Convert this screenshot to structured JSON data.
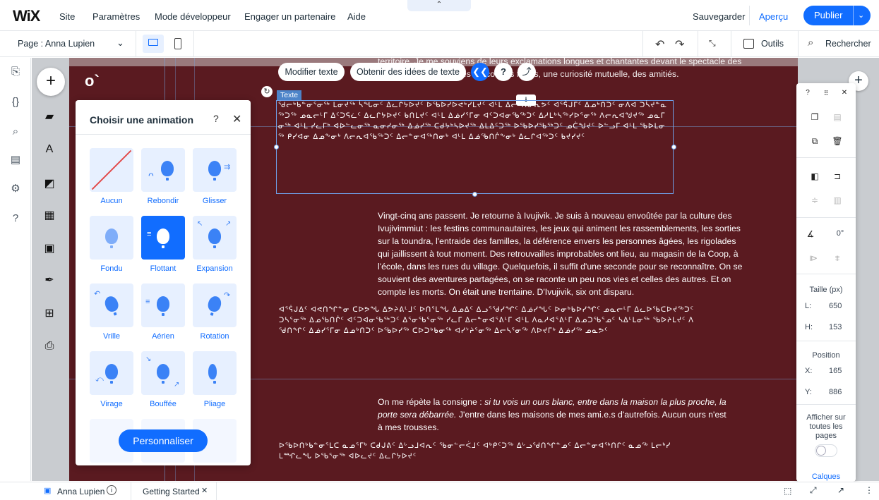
{
  "topbar": {
    "logo": "WiX",
    "menu": [
      "Site",
      "Paramètres",
      "Mode développeur",
      "Engager un partenaire",
      "Aide"
    ],
    "save": "Sauvegarder",
    "preview": "Aperçu",
    "publish": "Publier"
  },
  "secbar": {
    "page_label": "Page : Anna Lupien",
    "tools": "Outils",
    "search": "Rechercher"
  },
  "canvas": {
    "selection_tag": "Texte",
    "floating_toolbar": {
      "edit_text": "Modifier texte",
      "text_ideas": "Obtenir des idées de texte"
    },
    "top_text": "territoire. Je me souviens de leurs exclamations longues et chantantes devant le spectacle des mondes, mais aussi des rencontres fortes, une curiosité mutuelle, des amitiés.",
    "selected_syllabics": "ᖁᓕᒃᑲᓐᓂᕐᓂᖅ ᒪᓂᔪᖅ ᓵᖓᓂᑦ ᐃᓚᒋᔭᐅᔪᑦ ᐅᖃᐅᓯᐅᕙᒃᓯᒪᔪᑦ ᐊᒻᒪ ᐃᓕᑦᑎᓂᕆᕗᑦ ᐊᕐᕌᒍᒥᑦ ᐃᓄᒃᑎᑐᑦ ᓂᐱᐊ ᑐᓵᔪᓐᓇᖅᑐᖅ ᓄᓇᓕᒻᒥ ᐃᑦᑐᕋᓛᑦ ᐃᓚᒋᔭᐅᔪᑦ ᑲᑎᒪᔪᑦ ᐊᒻᒪ ᐃᓅᓯᕐᒥᓂ ᐊᑦᑐᐊᓂᖃᖅᑐᑦ ᐃᓱᒪᒃᓴᖅᓯᐅᕐᓂᖅ ᐱᓕᕆᐊᖑᔪᖅ ᓄᓇᒥᓂᖅ ᐊᒻᒪ ᓯᓚᒥᒃ ᐊᐅᓪᓚᓂᖅ ᓇᓂᓯᓂᖅ ᐃᓅᓯᖅ ᑕᑯᔭᒃᓴᐅᔪᖅ ᐃᒪᐃᑦᑐᖅ ᐅᖃᐅᓯᖃᖅᑐᑦ ᓄᑖᖑᔪᑦ ᐅᓪᓗᒥ ᐊᒻᒪ ᖃᐅᒪᓂᖅ ᑭᓯᐊᓂ ᐃᓄᖕᓂᒃ ᐱᓕᕆᐊᖃᖅᑐᑦ ᐃᓕᓐᓂᐊᖅᑎᓂᒃ ᐊᒻᒪ ᐃᓅᖃᑎᒌᖕᓂᒃ ᐃᓚᒋᐊᖅᑐᑦ ᑲᔪᓯᔪᑦ",
    "paragraph2": "Vingt-cinq ans passent. Je retourne à Ivujivik. Je suis à nouveau envoûtée par la culture des Ivujivimmiut : les festins communautaires, les jeux qui animent les rassemblements, les sorties sur la toundra, l'entraide des familles, la déférence envers les personnes âgées, les rigolades qui jaillissent à tout moment. Des retrouvailles improbables ont lieu, au magasin de la Coop, à l'école, dans les rues du village. Quelquefois, il suffit d'une seconde pour se reconnaître. On se souvient des aventures partagées, on se raconte un peu nos vies et celles des autres. Et on compte les morts. On était une trentaine. D'Ivujivik, six ont disparu.",
    "syllabics2": "ᐊᕐᕌᒍᐃᑦ ᐊᕙᑎᖏᓐᓂ ᑕᐅᕗᖓ ᐃᕗᔨᕕᒻᒧᑦ ᐅᑎᕐᒪᖓ ᐃᓄᐃᑦ ᐃᓗᕐᖁᓯᖏᑦ ᐃᓅᓯᖓᑦ ᐅᓂᒃᑲᐅᓯᖏᑦ ᓄᓇᓕᒻᒥ ᐃᓚᐅᖃᑕᐅᔪᖅᑐᑦ ᑐᓴᕐᓂᖅ ᐃᓄᖃᑎᒌᑦ ᐊᑦᑐᐊᓂᖃᖅᑐᑦ ᐃᕐᓂᖃᕐᓂᖅ ᓯᓚᒥ ᐃᓕᓐᓂᐊᕐᕕᒻᒥ ᐊᒻᒪ ᐱᓇᓱᐊᕐᕕᒻᒥ ᐃᓄᑐᖃᕐᓄᑦ ᓴᐃᒻᒪᓂᖅ ᖃᐅᔨᒪᔪᑦ ᐱᖁᑎᖏᑦ ᐃᓅᓯᕐᒥᓂ ᐃᓄᒃᑎᑐᑦ ᐅᖃᐅᓯᖅ ᑕᐅᑐᒃᑲᓂᖅ ᐊᓯᔾᔨᕐᓂᖅ ᐃᓕᓴᕐᓂᖅ ᐱᐅᔪᒥᒃ ᐃᓅᓯᖅ ᓄᓇᕗᑦ",
    "paragraph3_prefix": "On me répète la consigne : ",
    "paragraph3_italic": "si tu vois un ours blanc, entre dans la maison la plus proche, la porte sera débarrée.",
    "paragraph3_suffix": " J'entre dans les maisons de mes ami.e.s d'autrefois. Aucun ours n'est à mes trousses.",
    "syllabics3": "ᐅᖃᐅᑎᒃᑲᓐᓂᕐᒪᑕ ᓇᓄᕐᒥᒃ ᑕᑯᒍᕕᑦ ᐃᒡᓗᒧᐊᕆᑦ ᖃᓂᓪᓕᐹᒧᑦ ᐊᒃᑭᑦᑐᖅ ᐃᒡᓗᖁᑎᖏᓐᓄᑦ ᐃᓕᓐᓂᐊᖅᑎᒋᑦ ᓇᓄᖅ ᒪᓕᒃᓯᒪᙱᓚᖓ ᐅᖃᕐᓂᖅ ᐊᐅᓚᔪᑦ ᐃᓚᒋᔭᐅᔪᑦ"
  },
  "anim_panel": {
    "title": "Choisir une animation",
    "items": [
      "Aucun",
      "Rebondir",
      "Glisser",
      "Fondu",
      "Flottant",
      "Expansion",
      "Vrille",
      "Aérien",
      "Rotation",
      "Virage",
      "Bouffée",
      "Pliage"
    ],
    "customize": "Personnaliser"
  },
  "right_panel": {
    "rotation": "0°",
    "size_title": "Taille (px)",
    "width_label": "L:",
    "width_value": "650",
    "height_label": "H:",
    "height_value": "153",
    "position_title": "Position",
    "x_label": "X:",
    "x_value": "165",
    "y_label": "Y:",
    "y_value": "886",
    "show_all_pages": "Afficher sur toutes les pages",
    "layers": "Calques"
  },
  "bottombar": {
    "tab1": "Anna Lupien",
    "tab2": "Getting Started"
  },
  "colors": {
    "accent": "#116dff",
    "page_bg": "#5a1a20"
  }
}
